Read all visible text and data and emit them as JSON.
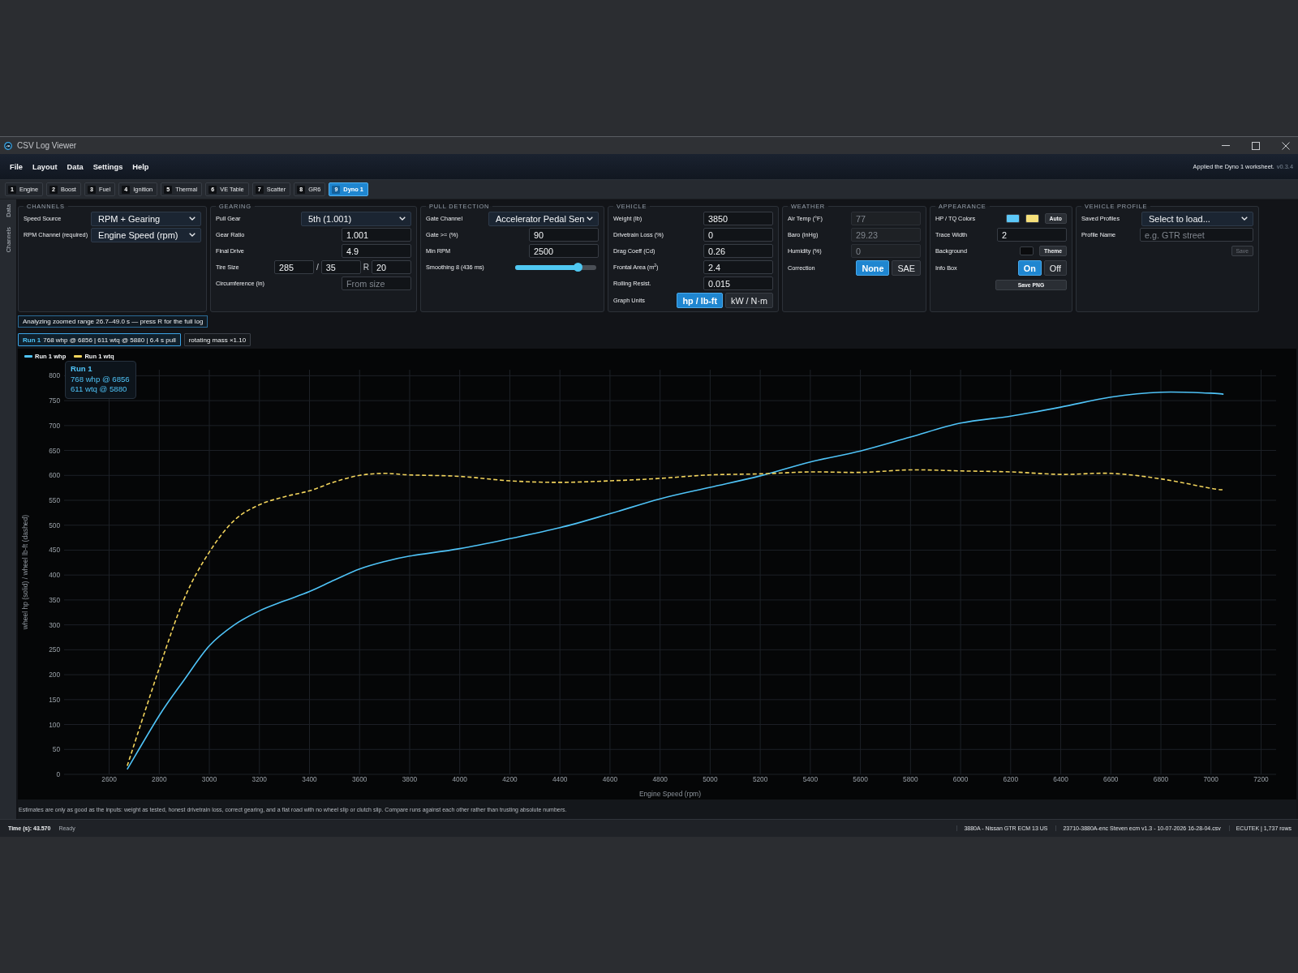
{
  "window": {
    "title": "CSV Log Viewer"
  },
  "menu": {
    "items": [
      "File",
      "Layout",
      "Data",
      "Settings",
      "Help"
    ],
    "message": "Applied the Dyno 1 worksheet.",
    "version": "v0.3.4"
  },
  "tabs": [
    {
      "number": "1",
      "label": "Engine",
      "selected": false
    },
    {
      "number": "2",
      "label": "Boost",
      "selected": false
    },
    {
      "number": "3",
      "label": "Fuel",
      "selected": false
    },
    {
      "number": "4",
      "label": "Ignition",
      "selected": false
    },
    {
      "number": "5",
      "label": "Thermal",
      "selected": false
    },
    {
      "number": "6",
      "label": "VE Table",
      "selected": false
    },
    {
      "number": "7",
      "label": "Scatter",
      "selected": false
    },
    {
      "number": "8",
      "label": "GR6",
      "selected": false
    },
    {
      "number": "9",
      "label": "Dyno 1",
      "selected": true
    }
  ],
  "side_tabs": [
    {
      "label": "Data"
    },
    {
      "label": "Channels"
    }
  ],
  "panels": [
    {
      "title": "CHANNELS",
      "rows": [
        {
          "kind": "select",
          "label": "Speed Source",
          "value": "RPM + Gearing"
        },
        {
          "kind": "select",
          "label": "RPM Channel (required)",
          "value": "Engine Speed (rpm)"
        }
      ]
    },
    {
      "title": "GEARING",
      "rows": [
        {
          "kind": "select",
          "label": "Pull Gear",
          "value": "5th (1.001)"
        },
        {
          "kind": "input",
          "label": "Gear Ratio",
          "value": "1.001",
          "disabled": false
        },
        {
          "kind": "input",
          "label": "Final Drive",
          "value": "4.9",
          "disabled": false
        },
        {
          "kind": "tire",
          "label": "Tire Size",
          "fields": [
            "285",
            "35",
            "20"
          ],
          "separators": [
            "/",
            "R"
          ]
        },
        {
          "kind": "input",
          "label": "Circumference (in)",
          "placeholder": "From size",
          "disabled": false
        }
      ]
    },
    {
      "title": "PULL DETECTION",
      "rows": [
        {
          "kind": "select",
          "label": "Gate Channel",
          "value": "Accelerator Pedal Sen"
        },
        {
          "kind": "input",
          "label": "Gate >= (%)",
          "value": "90",
          "disabled": false
        },
        {
          "kind": "input",
          "label": "Min RPM",
          "value": "2500",
          "disabled": false
        },
        {
          "kind": "slider",
          "label": "Smoothing 8 (436 ms)",
          "level": 0.77
        }
      ]
    },
    {
      "title": "VEHICLE",
      "rows": [
        {
          "kind": "input",
          "label": "Weight (lb)",
          "value": "3850",
          "disabled": false
        },
        {
          "kind": "input",
          "label": "Drivetrain Loss (%)",
          "value": "0",
          "disabled": false
        },
        {
          "kind": "input",
          "label": "Drag Coeff (Cd)",
          "value": "0.26",
          "disabled": false
        },
        {
          "kind": "input",
          "label": "Frontal Area (m$^{2}$)",
          "value": "2.4",
          "disabled": false
        },
        {
          "kind": "input",
          "label": "Rolling Resist.",
          "value": "0.015",
          "disabled": false
        },
        {
          "kind": "segmented",
          "label": "Graph Units",
          "options": [
            {
              "label": "hp / lb-ft",
              "selected": true
            },
            {
              "label": "kW / N·m",
              "selected": false
            }
          ]
        }
      ]
    },
    {
      "title": "WEATHER",
      "rows": [
        {
          "kind": "input",
          "label": "Air Temp (°F)",
          "value": "77",
          "disabled": true
        },
        {
          "kind": "input",
          "label": "Baro (inHg)",
          "value": "29.23",
          "disabled": true
        },
        {
          "kind": "input",
          "label": "Humidity (%)",
          "value": "0",
          "disabled": true
        },
        {
          "kind": "segmented",
          "label": "Correction",
          "options": [
            {
              "label": "None",
              "selected": true
            },
            {
              "label": "SAE",
              "selected": false
            }
          ]
        }
      ]
    },
    {
      "title": "APPEARANCE",
      "rows": [
        {
          "kind": "colors",
          "label": "HP / TQ Colors",
          "swatches": [
            {
              "color": "#5cc8f8"
            },
            {
              "color": "#f6e07a"
            }
          ],
          "button": "Auto"
        },
        {
          "kind": "input",
          "label": "Trace Width",
          "value": "2",
          "disabled": false
        },
        {
          "kind": "colors",
          "label": "Background",
          "swatches": [
            {
              "color": "#0b0c0e"
            }
          ],
          "button": "Theme"
        },
        {
          "kind": "segmented",
          "label": "Info Box",
          "options": [
            {
              "label": "On",
              "selected": true
            },
            {
              "label": "Off",
              "selected": false
            }
          ]
        },
        {
          "kind": "button",
          "text": "Save PNG",
          "disabled": false
        }
      ]
    },
    {
      "title": "VEHICLE PROFILE",
      "rows": [
        {
          "kind": "select",
          "label": "Saved Profiles",
          "value": "Select to load..."
        },
        {
          "kind": "input",
          "label": "Profile Name",
          "placeholder": "e.g. GTR street",
          "disabled": false
        },
        {
          "kind": "button",
          "text": "Save",
          "disabled": true
        }
      ]
    }
  ],
  "notice": "Analyzing zoomed range 26.7–49.0 s — press R for the full log",
  "runs": [
    {
      "name": "Run 1",
      "summary": "768 whp @ 6856 | 611 wtq @ 5880 | 6.4 s pull",
      "selected": true
    }
  ],
  "rotating_mass": "rotating mass ×1.10",
  "chart": {
    "info_box": {
      "title": "Run 1",
      "lines": [
        "768 whp @ 6856",
        "611 wtq @ 5880"
      ]
    },
    "chart_data": [
      {
        "type": "line",
        "xlabel": "Engine Speed (rpm)",
        "ylabel": "wheel hp (solid) / wheel lb-ft (dashed)",
        "x": [
          2672,
          2800,
          2900,
          3000,
          3100,
          3200,
          3300,
          3400,
          3500,
          3600,
          3700,
          3800,
          4000,
          4200,
          4400,
          4600,
          4800,
          5000,
          5200,
          5400,
          5600,
          5800,
          6000,
          6200,
          6400,
          6600,
          6800,
          7000,
          7050
        ],
        "series": [
          {
            "name": "Run 1 whp",
            "color": "#4fc3f7",
            "values": [
              10,
              118,
              190,
              258,
              300,
              328,
              348,
              367,
              390,
              412,
              427,
              438,
              453,
              473,
              495,
              523,
              553,
              576,
              599,
              627,
              649,
              677,
              705,
              719,
              737,
              757,
              767,
              765,
              763
            ]
          },
          {
            "name": "Run 1 wtq",
            "color": "#f2d45c",
            "line_style": "dashed",
            "values": [
              17,
              213,
              353,
              446,
              510,
              541,
              557,
              569,
              587,
              600,
              604,
              601,
              598,
              589,
              586,
              589,
              594,
              601,
              603,
              607,
              606,
              611,
              609,
              607,
              602,
              604,
              593,
              574,
              571
            ]
          }
        ],
        "xlim": [
          2420,
          7260
        ],
        "ylim": [
          0,
          812
        ],
        "xticks": [
          2600,
          2800,
          3000,
          3200,
          3400,
          3600,
          3800,
          4000,
          4200,
          4400,
          4600,
          4800,
          5000,
          5200,
          5400,
          5600,
          5800,
          6000,
          6200,
          6400,
          6600,
          6800,
          7000,
          7200
        ],
        "yticks": [
          0,
          50,
          100,
          150,
          200,
          250,
          300,
          350,
          400,
          450,
          500,
          550,
          600,
          650,
          700,
          750,
          800
        ],
        "grid": true,
        "legend": "top-left"
      }
    ]
  },
  "footnote": "Estimates are only as good as the inputs: weight as tested, honest drivetrain loss, correct gearing, and a flat road with no wheel slip or clutch slip. Compare runs against each other rather than trusting absolute numbers.",
  "status_bar": {
    "time": "Time (s): 43.570",
    "state": "Ready",
    "items": [
      "3880A - Nissan GTR ECM 13 US",
      "23710-3880A-enc Steven ecm v1.3 - 10-07-2026 16-28-04.csv",
      "ECUTEK | 1,737 rows"
    ]
  }
}
